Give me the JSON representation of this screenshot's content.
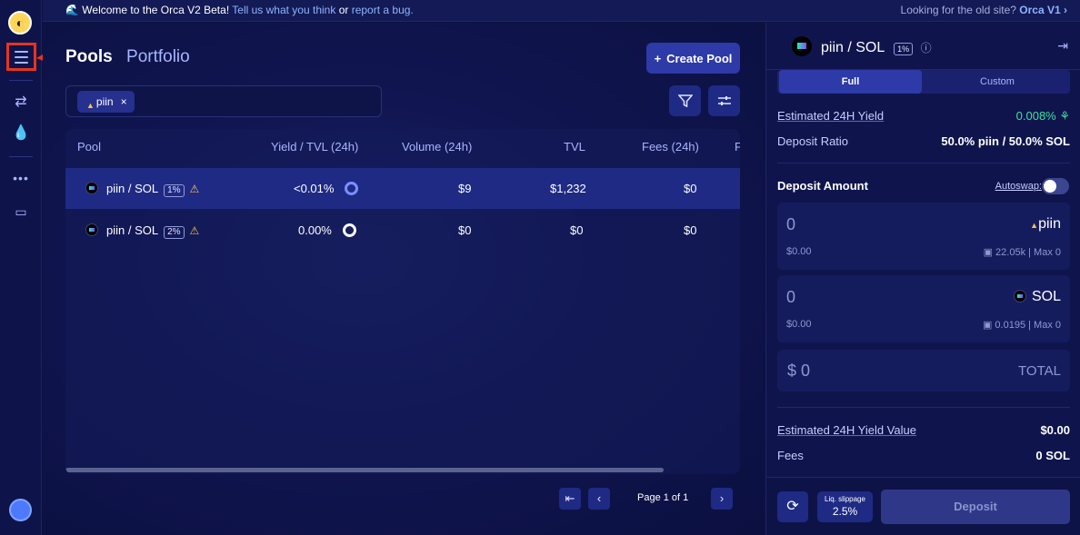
{
  "banner": {
    "emoji": "🌊",
    "welcome": "Welcome to the Orca V2 Beta!",
    "tell_link": "Tell us what you think",
    "or": "or",
    "report_link": "report a bug.",
    "old_site": "Looking for the old site?",
    "old_link": "Orca V1 ›"
  },
  "tabs": {
    "pools": "Pools",
    "portfolio": "Portfolio"
  },
  "create_pool": {
    "plus": "+",
    "label": "Create Pool"
  },
  "filter": {
    "chip_label": "piin",
    "chip_close": "×"
  },
  "table": {
    "headers": [
      "Pool",
      "Yield / TVL (24h)",
      "Volume (24h)",
      "TVL",
      "Fees (24h)",
      "F"
    ],
    "rows": [
      {
        "pair": "piin / SOL",
        "fee": "1%",
        "yield": "<0.01%",
        "volume": "$9",
        "tvl": "$1,232",
        "fees": "$0"
      },
      {
        "pair": "piin / SOL",
        "fee": "2%",
        "yield": "0.00%",
        "volume": "$0",
        "tvl": "$0",
        "fees": "$0"
      }
    ]
  },
  "pager": {
    "first": "⇤",
    "prev": "‹",
    "page": "Page 1 of 1",
    "next": "›"
  },
  "panel": {
    "pair": "piin / SOL",
    "fee": "1%",
    "info": "ⓘ",
    "close": "⇥",
    "seg_full": "Full",
    "seg_custom": "Custom",
    "est_yield_label": "Estimated 24H Yield",
    "est_yield_value": "0.008% ⚘",
    "ratio_label": "Deposit Ratio",
    "ratio_value": "50.0% piin / 50.0% SOL",
    "deposit_amount": "Deposit Amount",
    "autoswap": "Autoswap:",
    "in1": {
      "amount": "0",
      "usd": "$0.00",
      "token": "piin",
      "balance": "22.05k | Max 0"
    },
    "in2": {
      "amount": "0",
      "usd": "$0.00",
      "token": "SOL",
      "balance": "0.0195 | Max 0"
    },
    "total_left": "$ 0",
    "total_right": "TOTAL",
    "est_value_label": "Estimated 24H Yield Value",
    "est_value": "$0.00",
    "fees_label": "Fees",
    "fees_value": "0 SOL",
    "slippage_label": "Liq. slippage",
    "slippage_value": "2.5%",
    "deposit": "Deposit"
  },
  "colors": {
    "accent": "#2d3aa8",
    "annotation": "#e8331f",
    "positive": "#3fe0a0",
    "warning": "#ffc247"
  }
}
